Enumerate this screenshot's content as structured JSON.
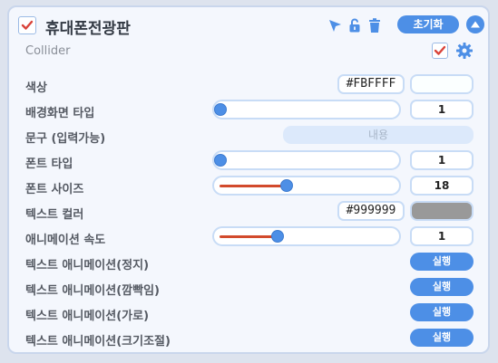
{
  "header": {
    "title": "휴대폰전광판",
    "reset_label": "초기화",
    "icons": [
      "select-cursor-icon",
      "lock-open-icon",
      "trash-icon",
      "collapse-up-icon"
    ]
  },
  "component": {
    "subtitle": "Collider",
    "icons": [
      "checkbox-checked-icon",
      "gear-icon"
    ]
  },
  "colors": {
    "accent": "#4d8fe6",
    "check": "#d9433a",
    "slider_fill": "#d24a2c",
    "background_color_value": "#FBFFFF",
    "text_color_value": "#999999"
  },
  "rows": {
    "color": {
      "label": "색상",
      "hex": "#FBFFFF"
    },
    "bg_type": {
      "label": "배경화면 타입",
      "value": "1",
      "level": 0
    },
    "phrase": {
      "label": "문구 (입력가능)",
      "placeholder": "내용"
    },
    "font_type": {
      "label": "폰트 타입",
      "value": "1",
      "level": 0
    },
    "font_size": {
      "label": "폰트 사이즈",
      "value": "18",
      "level": 0.38
    },
    "text_color": {
      "label": "텍스트 컬러",
      "hex": "#999999"
    },
    "anim_speed": {
      "label": "애니메이션 속도",
      "value": "1",
      "level": 0.33
    },
    "anim_stop": {
      "label": "텍스트 애니메이션(정지)",
      "button": "실행"
    },
    "anim_blink": {
      "label": "텍스트 애니메이션(깜빡임)",
      "button": "실행"
    },
    "anim_horizontal": {
      "label": "텍스트 애니메이션(가로)",
      "button": "실행"
    },
    "anim_scale": {
      "label": "텍스트 애니메이션(크기조절)",
      "button": "실행"
    }
  }
}
